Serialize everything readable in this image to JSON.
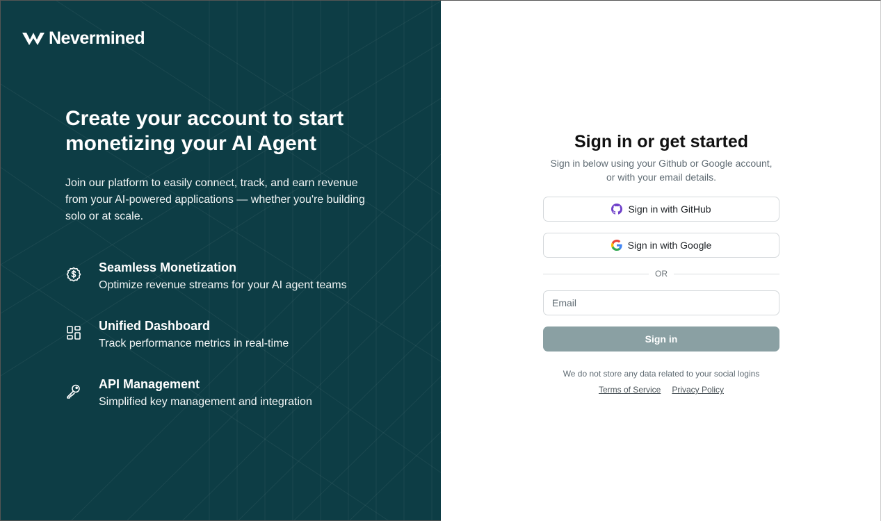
{
  "colors": {
    "panel_bg": "#0d3d45",
    "accent": "#8aa0a3",
    "muted_text": "#5f6b73"
  },
  "brand": {
    "name": "Nevermined",
    "logo_icon": "nevermined-logo-icon"
  },
  "hero": {
    "headline": "Create your account to start monetizing your AI Agent",
    "intro": "Join our platform to easily connect, track, and earn revenue from your AI-powered applications — whether you're building solo or at scale."
  },
  "features": [
    {
      "icon": "dollar-coin-icon",
      "title": "Seamless Monetization",
      "description": "Optimize revenue streams for your AI agent teams"
    },
    {
      "icon": "dashboard-grid-icon",
      "title": "Unified Dashboard",
      "description": "Track performance metrics in real-time"
    },
    {
      "icon": "key-icon",
      "title": "API Management",
      "description": "Simplified key management and integration"
    }
  ],
  "signin": {
    "title": "Sign in or get started",
    "subtitle_line1": "Sign in below using your Github or Google account,",
    "subtitle_line2": "or with your email details.",
    "github_label": "Sign in with GitHub",
    "google_label": "Sign in with Google",
    "divider_label": "OR",
    "email_placeholder": "Email",
    "submit_label": "Sign in",
    "privacy_note": "We do not store any data related to your social logins",
    "terms_label": "Terms of Service",
    "privacy_label": "Privacy Policy"
  }
}
